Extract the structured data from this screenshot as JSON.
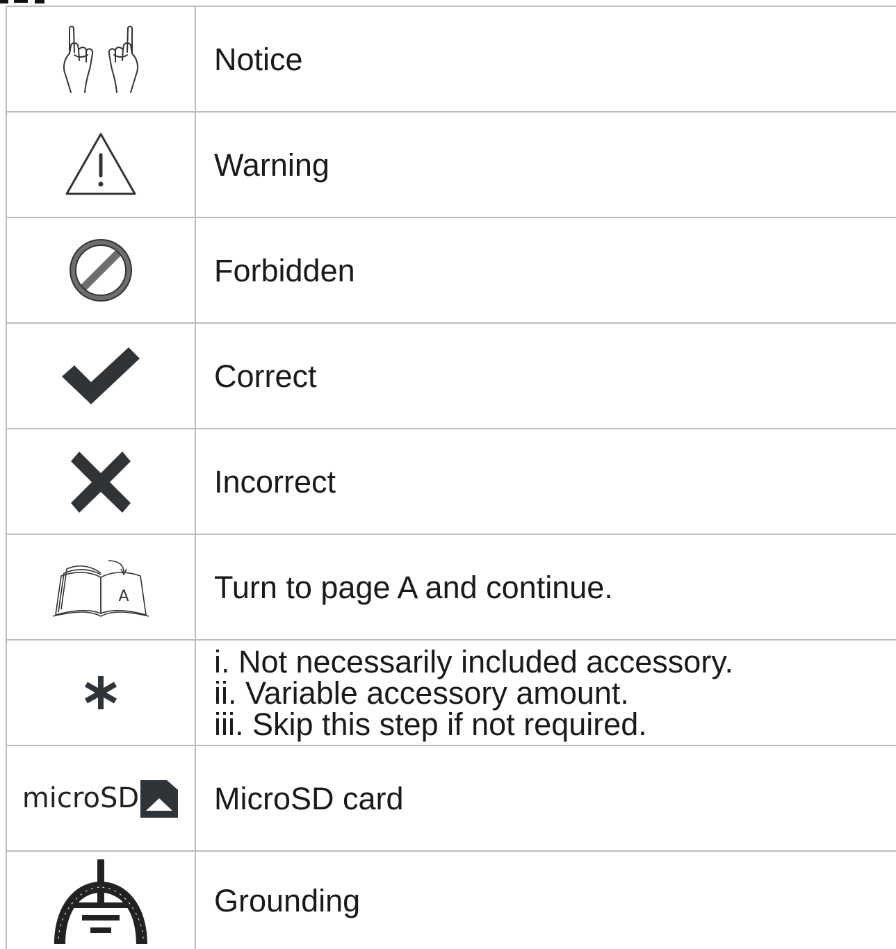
{
  "rows": [
    {
      "icon": "notice-hands-icon",
      "label": "Notice"
    },
    {
      "icon": "warning-triangle-icon",
      "label": "Warning"
    },
    {
      "icon": "forbidden-icon",
      "label": "Forbidden"
    },
    {
      "icon": "checkmark-icon",
      "label": "Correct"
    },
    {
      "icon": "cross-icon",
      "label": "Incorrect"
    },
    {
      "icon": "open-book-page-icon",
      "label": "Turn to page A and continue.",
      "icon_text": "A"
    },
    {
      "icon": "asterisk-icon",
      "lines": [
        "i. Not necessarily included accessory.",
        "ii. Variable accessory amount.",
        "iii. Skip this step if not required."
      ]
    },
    {
      "icon": "microsd-card-icon",
      "icon_text": "microSD",
      "label": "MicroSD card"
    },
    {
      "icon": "grounding-icon",
      "label": "Grounding"
    }
  ],
  "colors": {
    "border": "#bdbdbd",
    "icon_dark": "#2f3439",
    "forbidden_gray": "#6e6e6e"
  }
}
